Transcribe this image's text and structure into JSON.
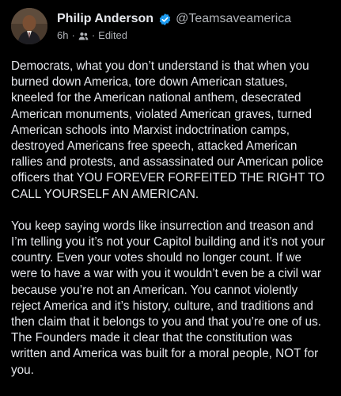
{
  "post": {
    "author": {
      "name": "Philip Anderson",
      "handle": "@Teamsaveamerica",
      "verified": true
    },
    "time": "6h",
    "separator": "·",
    "edited_label": "Edited",
    "audience_icon": "friends-icon",
    "paragraphs": [
      "Democrats, what you don’t understand is that when you burned down America, tore down American statues, kneeled for the American national anthem, desecrated American monuments, violated American graves, turned American schools into Marxist indoctrination camps, destroyed Americans free speech, attacked American rallies and protests, and assassinated our American police officers that YOU FOREVER FORFEITED THE RIGHT TO CALL YOURSELF AN AMERICAN.",
      "You keep saying words like insurrection and treason and I’m telling you it’s not your Capitol building and it’s not your country. Even your votes should no longer count. If we were to have a war with you it wouldn’t even be a civil war because you’re not an American. You cannot violently reject America and it’s history, culture, and traditions and then claim that it belongs to you and that you’re one of us. The Founders made it clear that the constitution was written and America was built for a moral people, NOT for you."
    ]
  },
  "colors": {
    "background": "#000000",
    "text": "#e4e6eb",
    "secondary_text": "#b0b3b8",
    "verified_badge": "#1d9bf0"
  }
}
